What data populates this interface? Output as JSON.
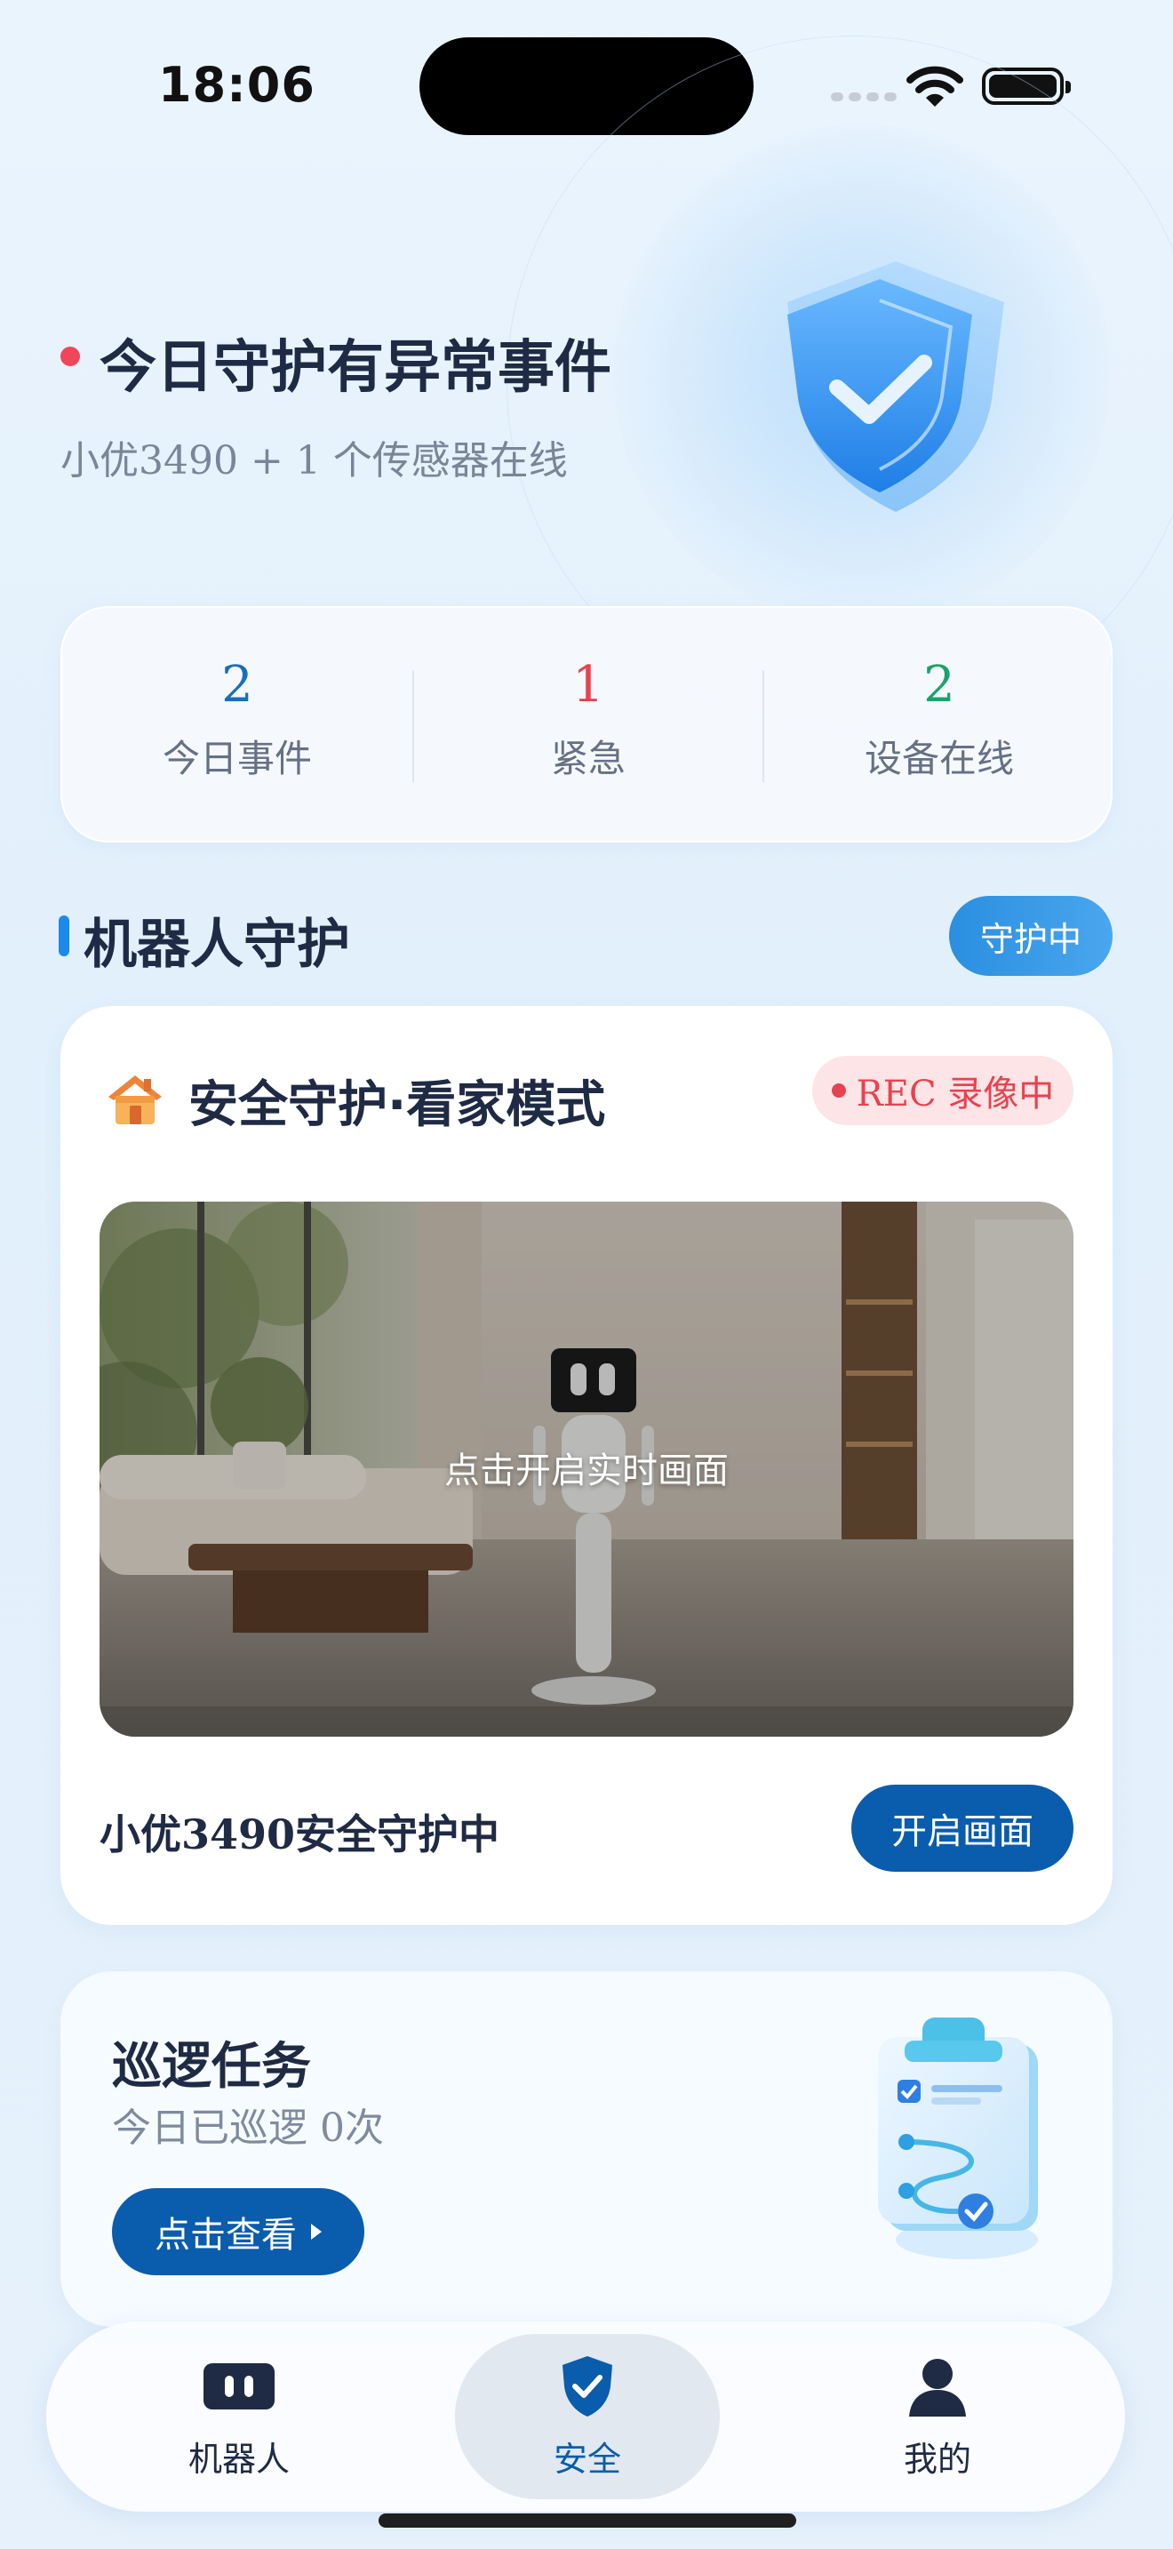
{
  "status_bar": {
    "time": "18:06"
  },
  "header": {
    "title": "今日守护有异常事件",
    "subtitle": "小优3490 + 1 个传感器在线"
  },
  "stats": [
    {
      "value": "2",
      "label": "今日事件",
      "color": "#1a6fb8"
    },
    {
      "value": "1",
      "label": "紧急",
      "color": "#e8424f"
    },
    {
      "value": "2",
      "label": "设备在线",
      "color": "#1aa26a"
    }
  ],
  "robot_guard": {
    "section_title": "机器人守护",
    "status_pill": "守护中",
    "card": {
      "mode_title": "安全守护·看家模式",
      "rec_badge": "REC 录像中",
      "live_view_prompt": "点击开启实时画面",
      "guard_status": "小优3490安全守护中",
      "open_button": "开启画面"
    }
  },
  "patrol": {
    "title": "巡逻任务",
    "subtitle": "今日已巡逻 0次",
    "view_button": "点击查看"
  },
  "tab_bar": {
    "tabs": [
      {
        "label": "机器人",
        "icon": "robot-icon",
        "active": false
      },
      {
        "label": "安全",
        "icon": "shield-check-icon",
        "active": true
      },
      {
        "label": "我的",
        "icon": "user-icon",
        "active": false
      }
    ]
  },
  "colors": {
    "primary_button": "#0a5cad",
    "accent_blue": "#1a8bea",
    "alert_red": "#e8424f",
    "online_green": "#1aa26a"
  }
}
